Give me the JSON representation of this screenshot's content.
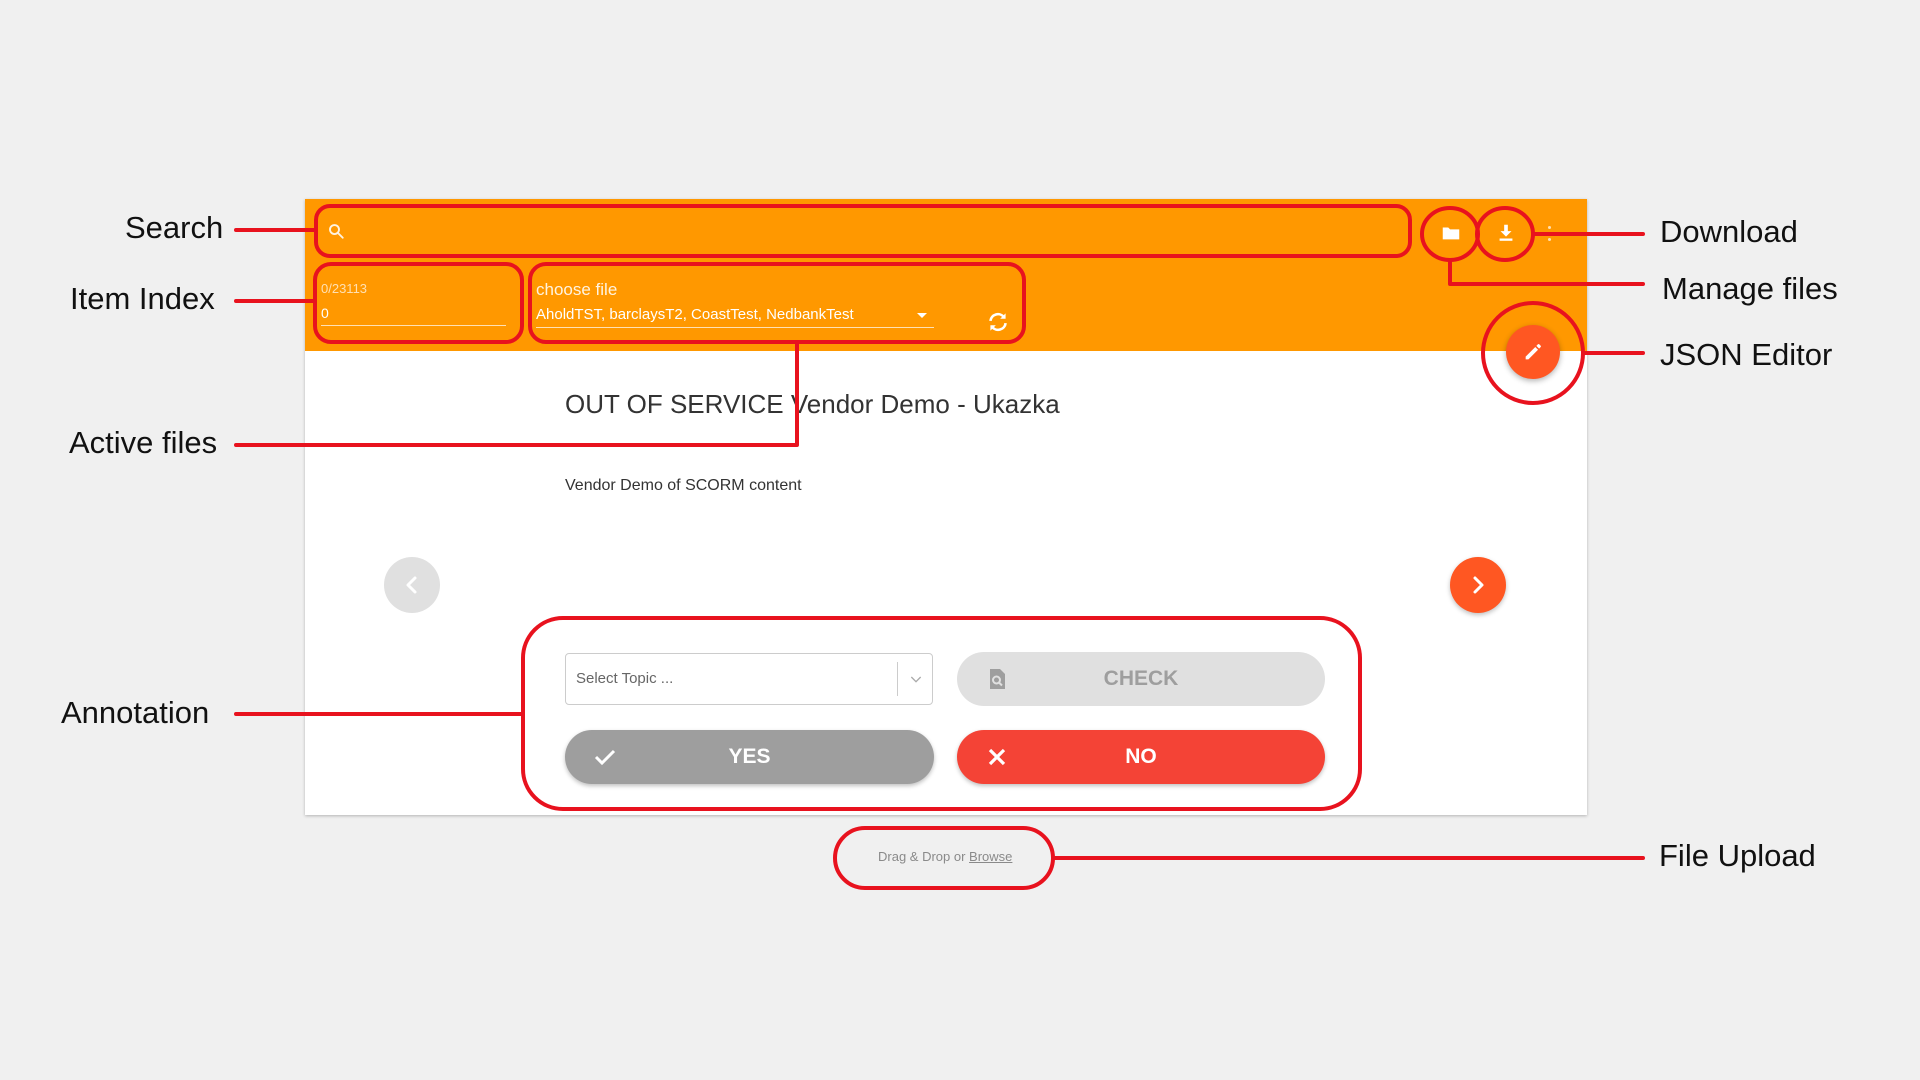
{
  "toolbar": {
    "search_placeholder": "",
    "folder_icon": "folder-icon",
    "download_icon": "download-icon",
    "more_icon": "more-vert-icon"
  },
  "item_index": {
    "count": "0/23113",
    "value": "0"
  },
  "file_select": {
    "label": "choose file",
    "value": "AholdTST, barclaysT2, CoastTest, NedbankTest"
  },
  "item": {
    "title": "OUT OF SERVICE Vendor Demo - Ukazka",
    "description": "Vendor Demo of SCORM content"
  },
  "annotation": {
    "topic_placeholder": "Select Topic ...",
    "check_label": "CHECK",
    "yes_label": "YES",
    "no_label": "NO"
  },
  "upload": {
    "text": "Drag & Drop or",
    "link": "Browse"
  },
  "callouts": {
    "search": "Search",
    "item_index": "Item Index",
    "active_files": "Active files",
    "annotation": "Annotation",
    "download": "Download",
    "manage_files": "Manage files",
    "json_editor": "JSON Editor",
    "file_upload": "File Upload"
  },
  "colors": {
    "toolbar": "#ff9800",
    "accent": "#ff5722",
    "no": "#f44336",
    "yes": "#9e9e9e",
    "callout": "#e8121e"
  }
}
